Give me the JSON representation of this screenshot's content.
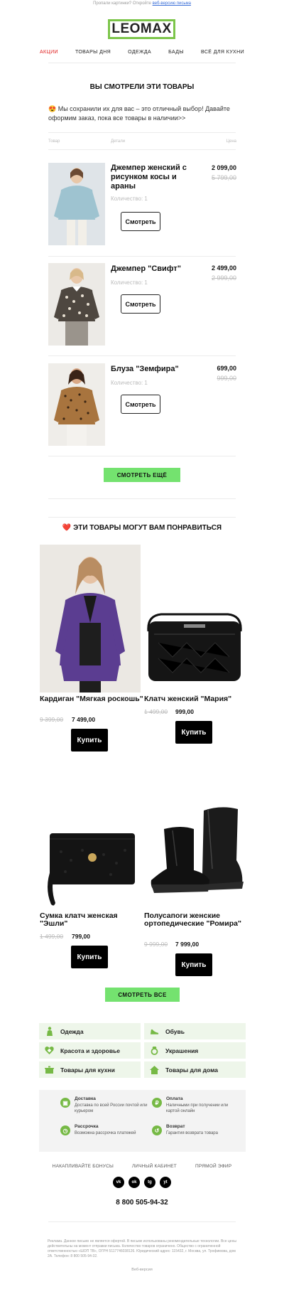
{
  "preheader": {
    "text": "Пропали картинки? Откройте",
    "link": "веб-версию письма"
  },
  "logo": {
    "text": "LEOMAX"
  },
  "nav": {
    "items": [
      "АКЦИИ",
      "ТОВАРЫ ДНЯ",
      "ОДЕЖДА",
      "БАДЫ",
      "ВСЁ ДЛЯ КУХНИ"
    ]
  },
  "viewed": {
    "title": "ВЫ СМОТРЕЛИ ЭТИ ТОВАРЫ",
    "intro": "😍 Мы сохранили их для вас – это отличный выбор! Давайте оформим заказ, пока все товары в наличии>>",
    "col_product": "Товар",
    "col_details": "Детали",
    "col_price": "Цена",
    "items": [
      {
        "name": "Джемпер женский с рисунком косы и араны",
        "qty": "Количество: 1",
        "price": "2 099,00",
        "old_price": "5 799,00",
        "button": "Смотреть"
      },
      {
        "name": "Джемпер \"Свифт\"",
        "qty": "Количество: 1",
        "price": "2 499,00",
        "old_price": "2 999,00",
        "button": "Смотреть"
      },
      {
        "name": "Блуза \"Земфира\"",
        "qty": "Количество: 1",
        "price": "699,00",
        "old_price": "999,00",
        "button": "Смотреть"
      }
    ],
    "more_button": "СМОТРЕТЬ ЕЩЁ"
  },
  "recommend": {
    "title": "❤️ ЭТИ ТОВАРЫ МОГУТ ВАМ ПОНРАВИТЬСЯ",
    "cards": [
      {
        "name": "Кардиган \"Мягкая роскошь\"",
        "old_price": "9 399,00",
        "price": "7 499,00",
        "button": "Купить"
      },
      {
        "name": "Клатч женский \"Мария\"",
        "old_price": "1 499,00",
        "price": "999,00",
        "button": "Купить"
      },
      {
        "name": "Сумка клатч женская \"Эшли\"",
        "old_price": "1 499,00",
        "price": "799,00",
        "button": "Купить"
      },
      {
        "name": "Полусапоги женские ортопедические \"Ромира\"",
        "old_price": "9 999,00",
        "price": "7 999,00",
        "button": "Купить"
      }
    ],
    "all_button": "СМОТРЕТЬ ВСЕ"
  },
  "categories": [
    {
      "label": "Одежда",
      "icon": "clothing-icon"
    },
    {
      "label": "Обувь",
      "icon": "shoe-icon"
    },
    {
      "label": "Красота и здоровье",
      "icon": "health-icon"
    },
    {
      "label": "Украшения",
      "icon": "ring-icon"
    },
    {
      "label": "Товары для кухни",
      "icon": "pot-icon"
    },
    {
      "label": "Товары для дома",
      "icon": "home-icon"
    }
  ],
  "info": [
    {
      "title": "Доставка",
      "desc": "Доставка по всей России почтой или курьером"
    },
    {
      "title": "Оплата",
      "desc": "Наличными при получении или картой онлайн"
    },
    {
      "title": "Рассрочка",
      "desc": "Возможна рассрочка платежей"
    },
    {
      "title": "Возврат",
      "desc": "Гарантия возврата товара"
    }
  ],
  "footer": {
    "links": [
      "НАКАПЛИВАЙТЕ БОНУСЫ",
      "ЛИЧНЫЙ КАБИНЕТ",
      "ПРЯМОЙ ЭФИР"
    ],
    "social": [
      "vk",
      "ok",
      "tg",
      "yt"
    ],
    "phone": "8 800 505-94-32",
    "legal": "Реклама. Данное письмо не является офертой. В письме использованы рекомендательные технологии. Все цены действительны на момент отправки письма. Количество товаров ограничено. Общество с ограниченной ответственностью «ШОП ТВ», ОГРН 5117746038126. Юридический адрес: 115432, г. Москва, ул. Трофимова, дом 2А. Телефон: 8 800 505-94-32.",
    "webver": "Веб-версия"
  },
  "colors": {
    "accent_green": "#74e26f",
    "brand_green": "#7cc54a",
    "nav_red": "#e02020"
  }
}
